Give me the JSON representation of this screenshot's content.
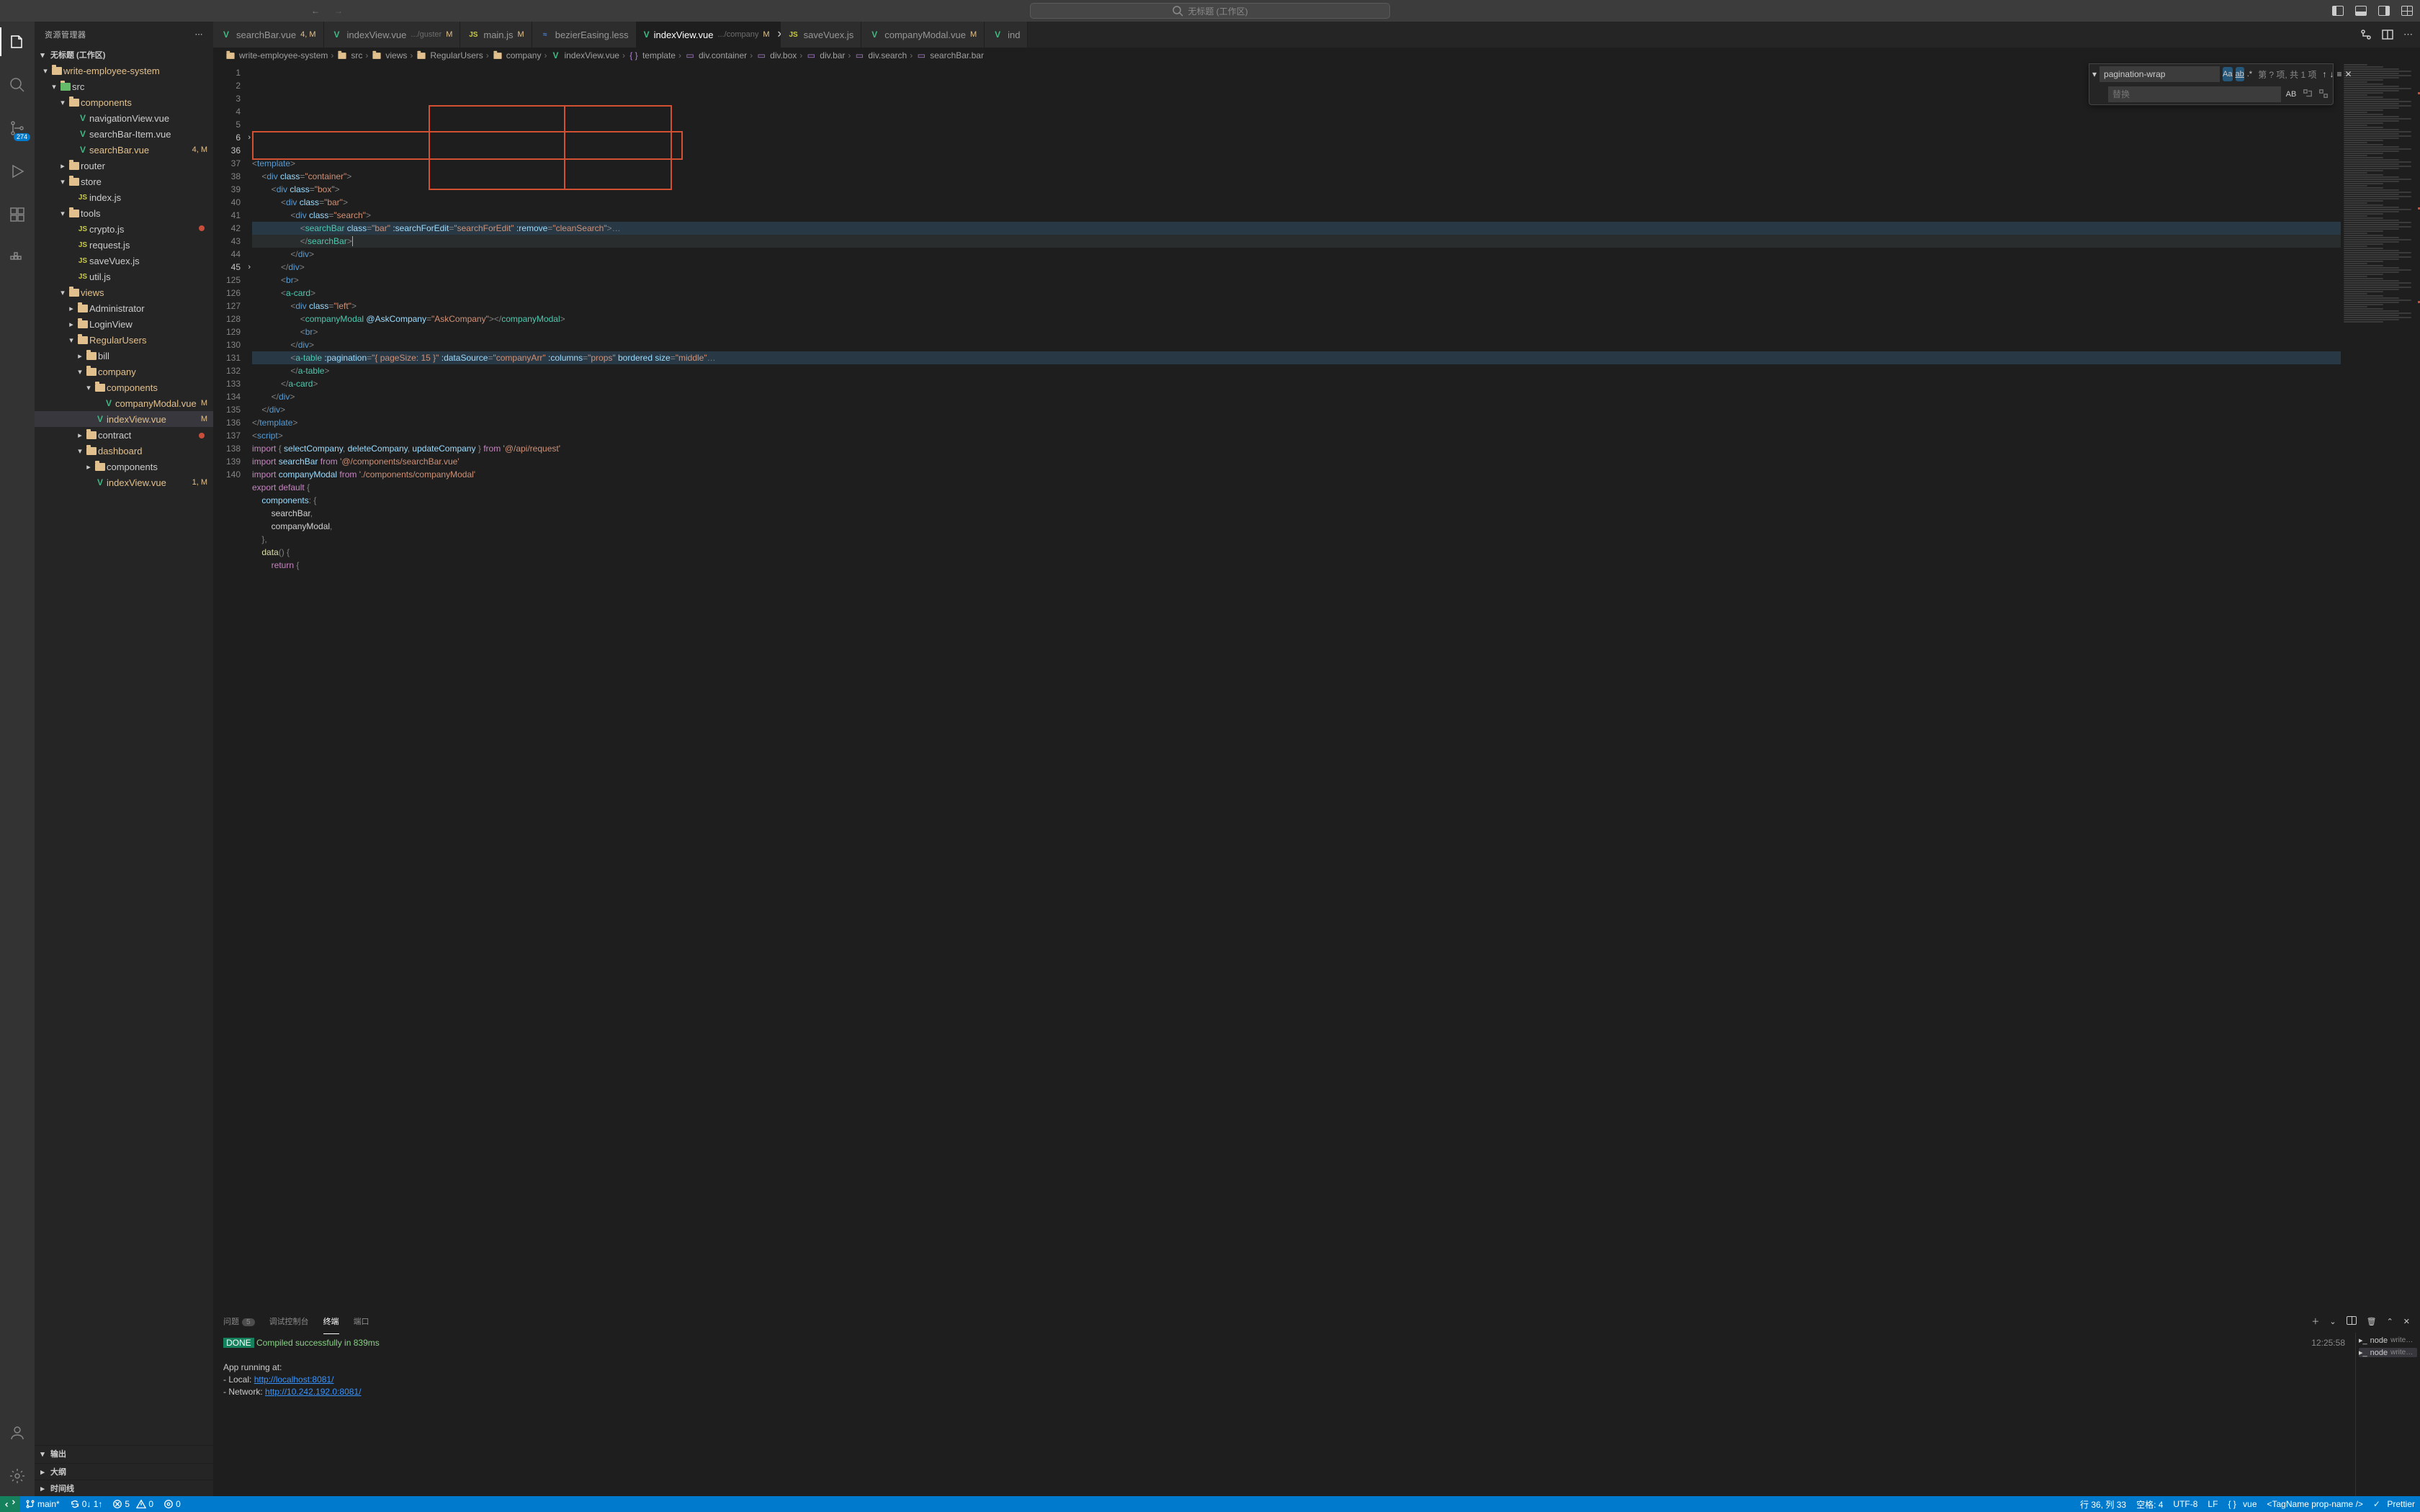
{
  "titlebar": {
    "title": "无标题 (工作区)"
  },
  "sidebar": {
    "header": "资源管理器",
    "workspace": "无标题 (工作区)",
    "scm_badge": "274",
    "tree": [
      {
        "depth": 0,
        "chev": "▾",
        "kind": "folder",
        "label": "write-employee-system",
        "mod": true
      },
      {
        "depth": 1,
        "chev": "▾",
        "kind": "folder-src",
        "label": "src"
      },
      {
        "depth": 2,
        "chev": "▾",
        "kind": "folder",
        "label": "components",
        "mod": true
      },
      {
        "depth": 3,
        "chev": "",
        "kind": "vue",
        "label": "navigationView.vue"
      },
      {
        "depth": 3,
        "chev": "",
        "kind": "vue",
        "label": "searchBar-Item.vue"
      },
      {
        "depth": 3,
        "chev": "",
        "kind": "vue",
        "label": "searchBar.vue",
        "badge": "4, M",
        "mod": true
      },
      {
        "depth": 2,
        "chev": "▸",
        "kind": "folder",
        "label": "router"
      },
      {
        "depth": 2,
        "chev": "▾",
        "kind": "folder",
        "label": "store"
      },
      {
        "depth": 3,
        "chev": "",
        "kind": "js",
        "label": "index.js"
      },
      {
        "depth": 2,
        "chev": "▾",
        "kind": "folder",
        "label": "tools"
      },
      {
        "depth": 3,
        "chev": "",
        "kind": "js",
        "label": "crypto.js"
      },
      {
        "depth": 3,
        "chev": "",
        "kind": "js",
        "label": "request.js"
      },
      {
        "depth": 3,
        "chev": "",
        "kind": "js",
        "label": "saveVuex.js"
      },
      {
        "depth": 3,
        "chev": "",
        "kind": "js",
        "label": "util.js"
      },
      {
        "depth": 2,
        "chev": "▾",
        "kind": "folder",
        "label": "views",
        "mod": true
      },
      {
        "depth": 3,
        "chev": "▸",
        "kind": "folder",
        "label": "Administrator"
      },
      {
        "depth": 3,
        "chev": "▸",
        "kind": "folder",
        "label": "LoginView"
      },
      {
        "depth": 3,
        "chev": "▾",
        "kind": "folder",
        "label": "RegularUsers",
        "mod": true
      },
      {
        "depth": 4,
        "chev": "▸",
        "kind": "folder",
        "label": "bill"
      },
      {
        "depth": 4,
        "chev": "▾",
        "kind": "folder",
        "label": "company",
        "mod": true
      },
      {
        "depth": 5,
        "chev": "▾",
        "kind": "folder",
        "label": "components",
        "mod": true
      },
      {
        "depth": 6,
        "chev": "",
        "kind": "vue",
        "label": "companyModal.vue",
        "badge": "M",
        "mod": true
      },
      {
        "depth": 5,
        "chev": "",
        "kind": "vue",
        "label": "indexView.vue",
        "badge": "M",
        "mod": true,
        "selected": true
      },
      {
        "depth": 4,
        "chev": "▸",
        "kind": "folder",
        "label": "contract"
      },
      {
        "depth": 4,
        "chev": "▾",
        "kind": "folder",
        "label": "dashboard",
        "mod": true
      },
      {
        "depth": 5,
        "chev": "▸",
        "kind": "folder",
        "label": "components"
      },
      {
        "depth": 5,
        "chev": "",
        "kind": "vue",
        "label": "indexView.vue",
        "badge": "1, M",
        "mod": true
      }
    ],
    "sections": {
      "output": "输出",
      "outline": "大纲",
      "timeline": "时间线"
    }
  },
  "tabs": [
    {
      "icon": "vue",
      "label": "searchBar.vue",
      "badge": "4, M"
    },
    {
      "icon": "vue",
      "label": "indexView.vue",
      "sub": ".../guster",
      "badge": "M"
    },
    {
      "icon": "js",
      "label": "main.js",
      "badge": "M"
    },
    {
      "icon": "less",
      "label": "bezierEasing.less"
    },
    {
      "icon": "vue",
      "label": "indexView.vue",
      "sub": ".../company",
      "badge": "M",
      "active": true,
      "close": true
    },
    {
      "icon": "js",
      "label": "saveVuex.js"
    },
    {
      "icon": "vue",
      "label": "companyModal.vue",
      "badge": "M"
    },
    {
      "icon": "vue",
      "label": "ind"
    }
  ],
  "breadcrumb": [
    "write-employee-system",
    "src",
    "views",
    "RegularUsers",
    "company",
    "indexView.vue",
    "template",
    "div.container",
    "div.box",
    "div.bar",
    "div.search",
    "searchBar.bar"
  ],
  "find": {
    "value": "pagination-wrap",
    "replace_placeholder": "替换",
    "count": "第 ? 项, 共 1 项"
  },
  "code": {
    "lines": [
      {
        "n": "1",
        "html": "<span class='punc'>&lt;</span><span class='t-tag'>template</span><span class='punc'>&gt;</span>"
      },
      {
        "n": "2",
        "html": "    <span class='punc'>&lt;</span><span class='t-tag'>div</span> <span class='t-attr'>class</span><span class='punc'>=</span><span class='t-str'>\"container\"</span><span class='punc'>&gt;</span>"
      },
      {
        "n": "3",
        "html": "        <span class='punc'>&lt;</span><span class='t-tag'>div</span> <span class='t-attr'>class</span><span class='punc'>=</span><span class='t-str'>\"box\"</span><span class='punc'>&gt;</span>"
      },
      {
        "n": "4",
        "html": "            <span class='punc'>&lt;</span><span class='t-tag'>div</span> <span class='t-attr'>class</span><span class='punc'>=</span><span class='t-str'>\"bar\"</span><span class='punc'>&gt;</span>"
      },
      {
        "n": "5",
        "html": "                <span class='punc'>&lt;</span><span class='t-tag'>div</span> <span class='t-attr'>class</span><span class='punc'>=</span><span class='t-str'>\"search\"</span><span class='punc'>&gt;</span>"
      },
      {
        "n": "6",
        "chev": "›",
        "hl": "hl2",
        "html": "                    <span class='punc'>&lt;</span><span class='t-comp'>searchBar</span> <span class='t-attr'>class</span><span class='punc'>=</span><span class='t-str'>\"bar\"</span> <span class='t-attr'>:searchForEdit</span><span class='punc'>=</span><span class='t-str'>\"searchForEdit\"</span> <span class='t-attr'>:remove</span><span class='punc'>=</span><span class='t-str'>\"cleanSearch\"</span><span class='punc'>&gt;</span><span class='punc'>…</span>"
      },
      {
        "n": "36",
        "hl": "hl",
        "html": "                    <span class='punc'>&lt;/</span><span class='t-comp'>searchBar</span><span class='punc'>&gt;</span><span style='border-left:1px solid #aeafad;'>&nbsp;</span>"
      },
      {
        "n": "37",
        "html": "                <span class='punc'>&lt;/</span><span class='t-tag'>div</span><span class='punc'>&gt;</span>"
      },
      {
        "n": "38",
        "html": "            <span class='punc'>&lt;/</span><span class='t-tag'>div</span><span class='punc'>&gt;</span>"
      },
      {
        "n": "39",
        "html": "            <span class='punc'>&lt;</span><span class='t-tag'>br</span><span class='punc'>&gt;</span>"
      },
      {
        "n": "40",
        "html": "            <span class='punc'>&lt;</span><span class='t-comp'>a-card</span><span class='punc'>&gt;</span>"
      },
      {
        "n": "41",
        "html": "                <span class='punc'>&lt;</span><span class='t-tag'>div</span> <span class='t-attr'>class</span><span class='punc'>=</span><span class='t-str'>\"left\"</span><span class='punc'>&gt;</span>"
      },
      {
        "n": "42",
        "dot": true,
        "html": "                    <span class='punc'>&lt;</span><span class='t-comp'>companyModal</span> <span class='t-attr'>@AskCompany</span><span class='punc'>=</span><span class='t-str'>\"AskCompany\"</span><span class='punc'>&gt;&lt;/</span><span class='t-comp'>companyModal</span><span class='punc'>&gt;</span>"
      },
      {
        "n": "43",
        "html": "                    <span class='punc'>&lt;</span><span class='t-tag'>br</span><span class='punc'>&gt;</span>"
      },
      {
        "n": "44",
        "html": "                <span class='punc'>&lt;/</span><span class='t-tag'>div</span><span class='punc'>&gt;</span>"
      },
      {
        "n": "45",
        "chev": "›",
        "hl": "hl2",
        "html": "                <span class='punc'>&lt;</span><span class='t-comp'>a-table</span> <span class='t-attr'>:pagination</span><span class='punc'>=</span><span class='t-str'>\"{ pageSize: 15 }\"</span> <span class='t-attr'>:dataSource</span><span class='punc'>=</span><span class='t-str'>\"companyArr\"</span> <span class='t-attr'>:columns</span><span class='punc'>=</span><span class='t-str'>\"props\"</span> <span class='t-attr'>bordered</span> <span class='t-attr'>size</span><span class='punc'>=</span><span class='t-str'>\"middle\"</span><span class='punc'>…</span>"
      },
      {
        "n": "125",
        "html": "                <span class='punc'>&lt;/</span><span class='t-comp'>a-table</span><span class='punc'>&gt;</span>"
      },
      {
        "n": "126",
        "html": "            <span class='punc'>&lt;/</span><span class='t-comp'>a-card</span><span class='punc'>&gt;</span>"
      },
      {
        "n": "127",
        "html": "        <span class='punc'>&lt;/</span><span class='t-tag'>div</span><span class='punc'>&gt;</span>"
      },
      {
        "n": "128",
        "html": "    <span class='punc'>&lt;/</span><span class='t-tag'>div</span><span class='punc'>&gt;</span>"
      },
      {
        "n": "129",
        "html": "<span class='punc'>&lt;/</span><span class='t-tag'>template</span><span class='punc'>&gt;</span>"
      },
      {
        "n": "130",
        "html": "<span class='punc'>&lt;</span><span class='t-tag'>script</span><span class='punc'>&gt;</span>"
      },
      {
        "n": "131",
        "html": "<span class='t-kw'>import</span> <span class='punc'>{</span> <span class='t-attr'>selectCompany</span><span class='punc'>,</span> <span class='t-attr'>deleteCompany</span><span class='punc'>,</span> <span class='t-attr'>updateCompany</span> <span class='punc'>}</span> <span class='t-kw'>from</span> <span class='t-str'>'@/api/request'</span>"
      },
      {
        "n": "132",
        "html": "<span class='t-kw'>import</span> <span class='t-attr'>searchBar</span> <span class='t-kw'>from</span> <span class='t-str'>'@/components/searchBar.vue'</span>"
      },
      {
        "n": "133",
        "html": "<span class='t-kw'>import</span> <span class='t-attr'>companyModal</span> <span class='t-kw'>from</span> <span class='t-str'>'./components/companyModal'</span>"
      },
      {
        "n": "134",
        "html": "<span class='t-kw'>export</span> <span class='t-kw'>default</span> <span class='punc'>{</span>"
      },
      {
        "n": "135",
        "html": "    <span class='t-attr'>components</span><span class='punc'>: {</span>"
      },
      {
        "n": "136",
        "html": "        <span class='t-txt'>searchBar</span><span class='punc'>,</span>"
      },
      {
        "n": "137",
        "dot": true,
        "html": "        <span class='t-txt'>companyModal</span><span class='punc'>,</span>"
      },
      {
        "n": "138",
        "html": "    <span class='punc'>},</span>"
      },
      {
        "n": "139",
        "html": "    <span class='t-fn'>data</span><span class='punc'>() {</span>"
      },
      {
        "n": "140",
        "html": "        <span class='t-kw'>return</span> <span class='punc'>{</span>"
      }
    ]
  },
  "panel": {
    "tabs": {
      "problems": "问题",
      "problems_count": "5",
      "debug": "调试控制台",
      "terminal": "终端",
      "ports": "端口"
    },
    "output": {
      "done": "DONE",
      "msg": "Compiled successfully in 839ms",
      "ts": "12:25:58",
      "running": "App running at:",
      "local_label": "- Local:   ",
      "local_url": "http://localhost:8081/",
      "network_label": "- Network: ",
      "network_url": "http://10.242.192.0:8081/"
    },
    "terminals": [
      {
        "label": "node",
        "detail": "write…"
      },
      {
        "label": "node",
        "detail": "write…",
        "active": true
      }
    ]
  },
  "statusbar": {
    "branch": "main*",
    "sync": "0↓ 1↑",
    "errors": "5",
    "warnings": "0",
    "ports": "0",
    "cursor": "行 36, 列 33",
    "spaces": "空格: 4",
    "encoding": "UTF-8",
    "eol": "LF",
    "lang": "vue",
    "selector": "<TagName prop-name />",
    "prettier": "Prettier"
  }
}
